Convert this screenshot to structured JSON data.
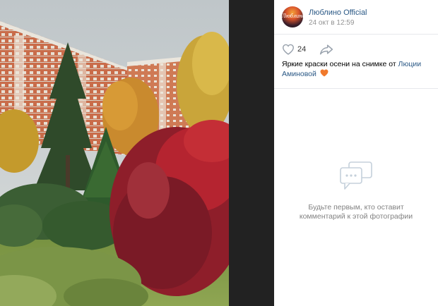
{
  "post": {
    "author": "Люблино Official",
    "date": "24 окт в 12:59",
    "avatar_text": "Люблино",
    "likes": "24",
    "caption_text": "Яркие краски осени на снимке от ",
    "caption_link": "Люции Аминовой",
    "caption_emoji": "orange-heart-icon"
  },
  "comments": {
    "empty_line1": "Будьте первым, кто оставит",
    "empty_line2": "комментарий к этой фотографии"
  },
  "colors": {
    "link": "#2a5885",
    "muted": "#939393",
    "viewer_bg": "#222222",
    "heart": "#f0792c"
  }
}
